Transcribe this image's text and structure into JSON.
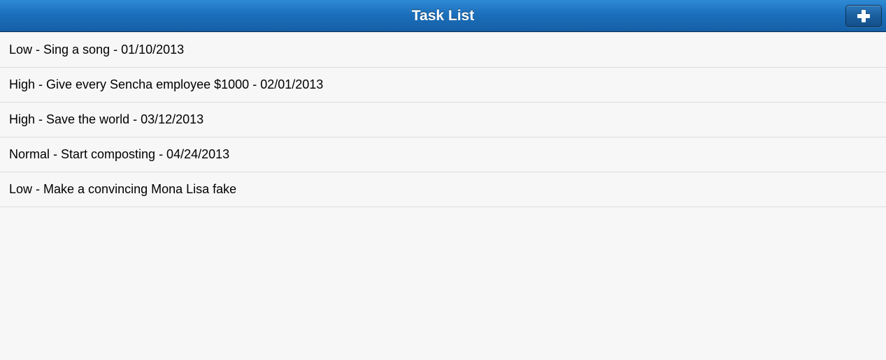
{
  "toolbar": {
    "title": "Task List",
    "add_button_icon": "plus-icon"
  },
  "tasks": [
    {
      "text": "Low - Sing a song - 01/10/2013"
    },
    {
      "text": "High - Give every Sencha employee $1000 - 02/01/2013"
    },
    {
      "text": "High - Save the world - 03/12/2013"
    },
    {
      "text": "Normal - Start composting - 04/24/2013"
    },
    {
      "text": "Low - Make a convincing Mona Lisa fake"
    }
  ],
  "colors": {
    "toolbar_blue": "#1b6fbb",
    "background": "#f7f7f7",
    "divider": "#dddddd"
  }
}
